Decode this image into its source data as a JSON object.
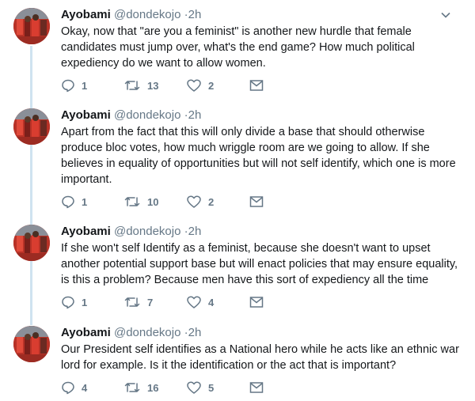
{
  "tweets": [
    {
      "name": "Ayobami",
      "handle": "@dondekojo",
      "separator": "·",
      "time": "2h",
      "text": "Okay, now that \"are you a feminist\" is another new hurdle that female candidates must jump over, what's the end game? How much political expediency do we want to allow women.",
      "replies": "1",
      "retweets": "13",
      "likes": "2"
    },
    {
      "name": "Ayobami",
      "handle": "@dondekojo",
      "separator": "·",
      "time": "2h",
      "text": "Apart from the fact that this will only divide a base that should otherwise produce bloc votes, how much wriggle room are we going to allow. If she believes in equality of opportunities but will not self identify, which one is more important.",
      "replies": "1",
      "retweets": "10",
      "likes": "2"
    },
    {
      "name": "Ayobami",
      "handle": "@dondekojo",
      "separator": "·",
      "time": "2h",
      "text": "If she won't self Identify as a feminist, because she doesn't want to upset another potential support base but will enact policies that may ensure equality, is this a problem? Because men have this sort of expediency all the time",
      "replies": "1",
      "retweets": "7",
      "likes": "4"
    },
    {
      "name": "Ayobami",
      "handle": "@dondekojo",
      "separator": "·",
      "time": "2h",
      "text": "Our President self identifies as a National hero while he acts like an ethnic war lord for example. Is it the identification or the act that is important?",
      "replies": "4",
      "retweets": "16",
      "likes": "5"
    }
  ],
  "colors": {
    "text": "#14171a",
    "secondary": "#657786",
    "thread_line": "#cfe3f0",
    "avatar_red": "#c0392b"
  },
  "icons": [
    "avatar",
    "chevron-down-icon",
    "reply-icon",
    "retweet-icon",
    "like-icon",
    "direct-message-icon"
  ]
}
